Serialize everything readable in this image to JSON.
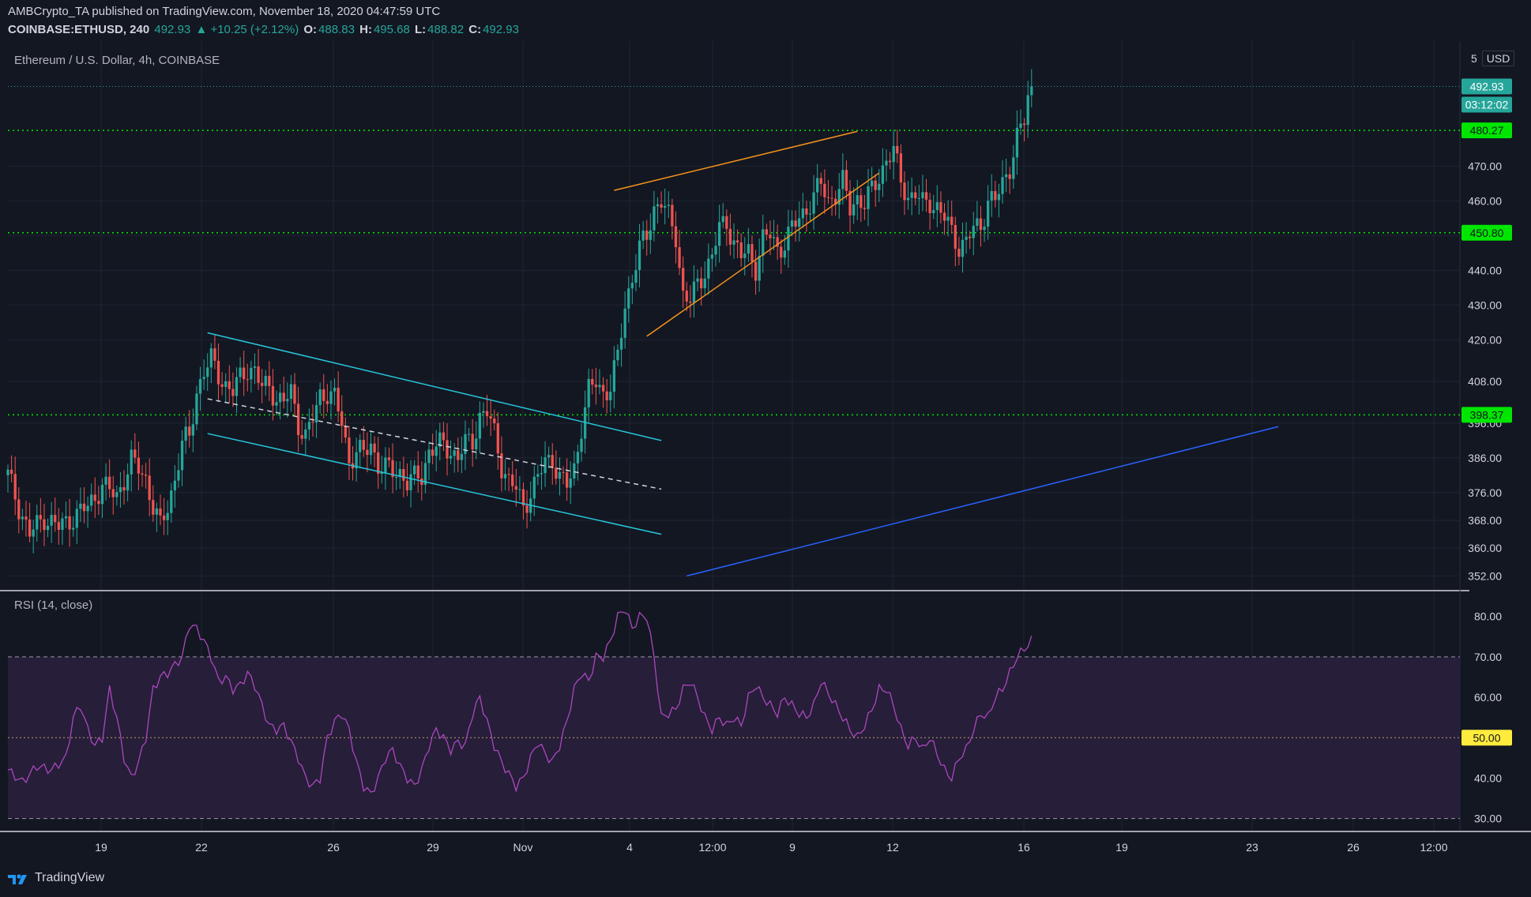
{
  "header": {
    "publisher": "AMBCrypto_TA published on TradingView.com, November 18, 2020 04:47:59 UTC",
    "symbol": "COINBASE:ETHUSD, 240",
    "last": "492.93",
    "change": "▲ +10.25 (+2.12%)",
    "o_label": "O:",
    "o_value": "488.83",
    "h_label": "H:",
    "h_value": "495.68",
    "l_label": "L:",
    "l_value": "488.82",
    "c_label": "C:",
    "c_value": "492.93"
  },
  "pane_title": "Ethereum / U.S. Dollar, 4h, COINBASE",
  "scale_control": {
    "scale": "5",
    "currency": "USD"
  },
  "rsi_title": "RSI (14, close)",
  "footer_brand": "TradingView",
  "colors": {
    "background": "#131722",
    "up": "#26a69a",
    "down": "#ef5350",
    "support": "#00e600",
    "channel": "#26c6da",
    "wedge": "#f7931a",
    "trend": "#2962ff",
    "rsi": "#ab47bc",
    "rsi_band": "#2a1f3d",
    "mid_label": "#ffeb3b"
  },
  "chart_data": [
    {
      "type": "candlestick",
      "title": "Ethereum / U.S. Dollar, 4h, COINBASE",
      "ylim": [
        348,
        506
      ],
      "y_ticks": [
        "352.00",
        "360.00",
        "368.00",
        "376.00",
        "386.00",
        "396.00",
        "408.00",
        "420.00",
        "430.00",
        "440.00",
        "450.00",
        "460.00",
        "470.00"
      ],
      "x_ticks": [
        "19",
        "22",
        "26",
        "29",
        "Nov",
        "4",
        "12:00",
        "9",
        "12",
        "16",
        "19",
        "23",
        "26",
        "12:00"
      ],
      "last_price": 492.93,
      "last_price_label": "492.93",
      "countdown_label": "03:12:02",
      "horizontal_levels": [
        {
          "value": 480.27,
          "label": "480.27"
        },
        {
          "value": 450.8,
          "label": "450.80"
        },
        {
          "value": 398.37,
          "label": "398.37"
        }
      ],
      "anchor_points": [
        [
          0,
          381
        ],
        [
          3,
          372
        ],
        [
          6,
          364
        ],
        [
          10,
          369
        ],
        [
          14,
          366
        ],
        [
          18,
          369
        ],
        [
          22,
          372
        ],
        [
          26,
          378
        ],
        [
          30,
          375
        ],
        [
          34,
          385
        ],
        [
          36,
          383
        ],
        [
          38,
          380
        ],
        [
          40,
          372
        ],
        [
          42,
          366
        ],
        [
          44,
          372
        ],
        [
          46,
          380
        ],
        [
          48,
          390
        ],
        [
          50,
          392
        ],
        [
          52,
          405
        ],
        [
          54,
          411
        ],
        [
          56,
          414
        ],
        [
          58,
          410
        ],
        [
          60,
          407
        ],
        [
          62,
          405
        ],
        [
          64,
          409
        ],
        [
          66,
          412
        ],
        [
          68,
          411
        ],
        [
          70,
          406
        ],
        [
          72,
          407
        ],
        [
          74,
          403
        ],
        [
          76,
          402
        ],
        [
          78,
          405
        ],
        [
          80,
          396
        ],
        [
          82,
          392
        ],
        [
          84,
          397
        ],
        [
          86,
          404
        ],
        [
          88,
          405
        ],
        [
          90,
          403
        ],
        [
          92,
          396
        ],
        [
          94,
          385
        ],
        [
          96,
          388
        ],
        [
          98,
          387
        ],
        [
          100,
          390
        ],
        [
          102,
          384
        ],
        [
          104,
          383
        ],
        [
          106,
          382
        ],
        [
          108,
          382
        ],
        [
          110,
          379
        ],
        [
          112,
          380
        ],
        [
          114,
          381
        ],
        [
          116,
          388
        ],
        [
          118,
          389
        ],
        [
          120,
          390
        ],
        [
          122,
          388
        ],
        [
          124,
          386
        ],
        [
          126,
          390
        ],
        [
          128,
          391
        ],
        [
          130,
          398
        ],
        [
          132,
          399
        ],
        [
          134,
          393
        ],
        [
          136,
          384
        ],
        [
          138,
          379
        ],
        [
          140,
          377
        ],
        [
          142,
          372
        ],
        [
          144,
          376
        ],
        [
          146,
          380
        ],
        [
          148,
          385
        ],
        [
          150,
          386
        ],
        [
          152,
          380
        ],
        [
          154,
          378
        ],
        [
          156,
          383
        ],
        [
          158,
          395
        ],
        [
          160,
          405
        ],
        [
          162,
          408
        ],
        [
          164,
          405
        ],
        [
          166,
          406
        ],
        [
          168,
          415
        ],
        [
          170,
          430
        ],
        [
          172,
          438
        ],
        [
          174,
          446
        ],
        [
          176,
          450
        ],
        [
          178,
          458
        ],
        [
          180,
          460
        ],
        [
          182,
          455
        ],
        [
          184,
          450
        ],
        [
          186,
          433
        ],
        [
          188,
          431
        ],
        [
          190,
          436
        ],
        [
          192,
          440
        ],
        [
          194,
          444
        ],
        [
          196,
          452
        ],
        [
          198,
          454
        ],
        [
          200,
          448
        ],
        [
          202,
          444
        ],
        [
          204,
          445
        ],
        [
          206,
          441
        ],
        [
          208,
          449
        ],
        [
          210,
          450
        ],
        [
          212,
          446
        ],
        [
          214,
          448
        ],
        [
          216,
          452
        ],
        [
          218,
          455
        ],
        [
          220,
          458
        ],
        [
          222,
          461
        ],
        [
          224,
          465
        ],
        [
          226,
          460
        ],
        [
          228,
          462
        ],
        [
          230,
          465
        ],
        [
          232,
          458
        ],
        [
          234,
          461
        ],
        [
          236,
          459
        ],
        [
          238,
          463
        ],
        [
          240,
          467
        ],
        [
          242,
          472
        ],
        [
          244,
          474
        ],
        [
          246,
          466
        ],
        [
          248,
          461
        ],
        [
          250,
          462
        ],
        [
          252,
          459
        ],
        [
          254,
          460
        ],
        [
          256,
          458
        ],
        [
          258,
          455
        ],
        [
          260,
          451
        ],
        [
          262,
          447
        ],
        [
          264,
          448
        ],
        [
          266,
          452
        ],
        [
          268,
          453
        ],
        [
          270,
          460
        ],
        [
          272,
          460
        ],
        [
          274,
          465
        ],
        [
          276,
          470
        ],
        [
          278,
          478
        ],
        [
          280,
          483
        ],
        [
          281,
          490
        ],
        [
          282,
          492.93
        ]
      ],
      "drawings": [
        {
          "type": "descending channel",
          "upper": [
            [
              55,
              422
            ],
            [
              180,
              391
            ]
          ],
          "middle": [
            [
              55,
              403
            ],
            [
              180,
              377
            ]
          ],
          "lower": [
            [
              55,
              393
            ],
            [
              180,
              364
            ]
          ]
        },
        {
          "type": "rising wedge",
          "upper": [
            [
              167,
              463
            ],
            [
              234,
              480
            ]
          ],
          "lower": [
            [
              176,
              421
            ],
            [
              240,
              468
            ]
          ]
        },
        {
          "type": "ascending trendline",
          "points": [
            [
              187,
              352
            ],
            [
              350,
              395
            ]
          ]
        }
      ]
    },
    {
      "type": "line",
      "title": "RSI (14, close)",
      "ylim": [
        27,
        86
      ],
      "y_ticks": [
        "30.00",
        "40.00",
        "60.00",
        "70.00",
        "80.00"
      ],
      "bands": {
        "upper": 70,
        "middle": 50,
        "lower": 30
      },
      "mid_label": "50.00",
      "anchor_points": [
        [
          0,
          42
        ],
        [
          4,
          39
        ],
        [
          8,
          43
        ],
        [
          12,
          42
        ],
        [
          16,
          45
        ],
        [
          18,
          55
        ],
        [
          20,
          58
        ],
        [
          22,
          52
        ],
        [
          24,
          48
        ],
        [
          26,
          50
        ],
        [
          28,
          62
        ],
        [
          30,
          55
        ],
        [
          32,
          45
        ],
        [
          34,
          40
        ],
        [
          36,
          44
        ],
        [
          38,
          50
        ],
        [
          40,
          62
        ],
        [
          42,
          65
        ],
        [
          44,
          66
        ],
        [
          48,
          70
        ],
        [
          50,
          78
        ],
        [
          52,
          77
        ],
        [
          54,
          74
        ],
        [
          56,
          70
        ],
        [
          58,
          64
        ],
        [
          60,
          65
        ],
        [
          62,
          62
        ],
        [
          64,
          63
        ],
        [
          66,
          66
        ],
        [
          68,
          63
        ],
        [
          70,
          58
        ],
        [
          72,
          53
        ],
        [
          74,
          52
        ],
        [
          76,
          53
        ],
        [
          78,
          49
        ],
        [
          80,
          45
        ],
        [
          82,
          40
        ],
        [
          84,
          38
        ],
        [
          86,
          40
        ],
        [
          88,
          50
        ],
        [
          90,
          54
        ],
        [
          92,
          56
        ],
        [
          94,
          52
        ],
        [
          96,
          44
        ],
        [
          98,
          38
        ],
        [
          100,
          36
        ],
        [
          102,
          40
        ],
        [
          104,
          45
        ],
        [
          106,
          47
        ],
        [
          108,
          43
        ],
        [
          110,
          40
        ],
        [
          112,
          38
        ],
        [
          114,
          42
        ],
        [
          116,
          48
        ],
        [
          118,
          52
        ],
        [
          120,
          50
        ],
        [
          122,
          47
        ],
        [
          124,
          49
        ],
        [
          126,
          48
        ],
        [
          128,
          56
        ],
        [
          130,
          60
        ],
        [
          132,
          54
        ],
        [
          134,
          48
        ],
        [
          136,
          44
        ],
        [
          138,
          41
        ],
        [
          140,
          38
        ],
        [
          142,
          40
        ],
        [
          144,
          45
        ],
        [
          146,
          49
        ],
        [
          148,
          46
        ],
        [
          150,
          44
        ],
        [
          152,
          48
        ],
        [
          154,
          54
        ],
        [
          156,
          62
        ],
        [
          158,
          66
        ],
        [
          160,
          64
        ],
        [
          162,
          70
        ],
        [
          164,
          70
        ],
        [
          166,
          74
        ],
        [
          168,
          80
        ],
        [
          170,
          82
        ],
        [
          172,
          77
        ],
        [
          174,
          80
        ],
        [
          176,
          80
        ],
        [
          178,
          70
        ],
        [
          180,
          55
        ],
        [
          182,
          56
        ],
        [
          184,
          57
        ],
        [
          186,
          62
        ],
        [
          188,
          64
        ],
        [
          190,
          60
        ],
        [
          192,
          55
        ],
        [
          194,
          52
        ],
        [
          196,
          55
        ],
        [
          198,
          53
        ],
        [
          200,
          55
        ],
        [
          202,
          53
        ],
        [
          204,
          60
        ],
        [
          206,
          63
        ],
        [
          208,
          60
        ],
        [
          210,
          58
        ],
        [
          212,
          56
        ],
        [
          214,
          60
        ],
        [
          216,
          58
        ],
        [
          218,
          56
        ],
        [
          220,
          55
        ],
        [
          222,
          58
        ],
        [
          224,
          64
        ],
        [
          226,
          61
        ],
        [
          228,
          58
        ],
        [
          230,
          55
        ],
        [
          232,
          52
        ],
        [
          234,
          50
        ],
        [
          236,
          53
        ],
        [
          238,
          57
        ],
        [
          240,
          62
        ],
        [
          242,
          62
        ],
        [
          244,
          58
        ],
        [
          246,
          52
        ],
        [
          248,
          48
        ],
        [
          250,
          50
        ],
        [
          252,
          47
        ],
        [
          254,
          50
        ],
        [
          256,
          46
        ],
        [
          258,
          42
        ],
        [
          260,
          40
        ],
        [
          262,
          45
        ],
        [
          264,
          47
        ],
        [
          266,
          52
        ],
        [
          268,
          56
        ],
        [
          270,
          55
        ],
        [
          272,
          60
        ],
        [
          274,
          62
        ],
        [
          276,
          66
        ],
        [
          278,
          70
        ],
        [
          280,
          72
        ],
        [
          282,
          74
        ]
      ]
    }
  ]
}
